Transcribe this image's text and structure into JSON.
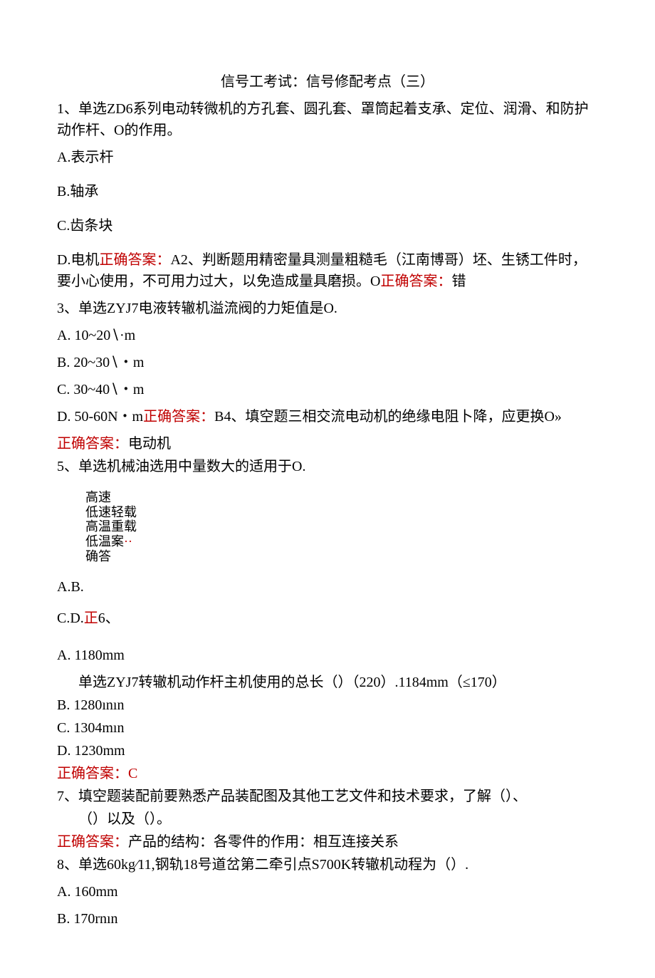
{
  "title": "信号工考试：信号修配考点（三）",
  "q1_stem": "1、单选ZD6系列电动转微机的方孔套、圆孔套、罩筒起着支承、定位、润滑、和防护动作杆、O的作用。",
  "q1_a": "A.表示杆",
  "q1_b": "B.轴承",
  "q1_c": "C.齿条块",
  "q1_d_prefix": "D.电机",
  "q1_ans_label": "正确答案：",
  "q1_ans_rest": "A2、判断题用精密量具测量粗糙毛（江南博哥）坯、生锈工件时，要小心使用，不可用力过大，以免造成量具磨损。O",
  "q2_ans_label": "正确答案：",
  "q2_ans_val": "错",
  "q3_stem": "3、单选ZYJ7电液转辙机溢流阀的力矩值是O.",
  "q3_a": "A.   10~20∖·m",
  "q3_b": "B.   20~30∖・m",
  "q3_c": "C.   30~40∖・m",
  "q3_d_prefix": "D.   50-60N・m",
  "q3_ans_label": "正确答案：",
  "q3_ans_rest": "B4、填空题三相交流电动机的绝缘电阻卜降，应更换O»",
  "q4_ans_label": "正确答案：",
  "q4_ans_val": "电动机",
  "q5_stem": "5、单选机械油选用中量数大的适用于O.",
  "q5_block_l1": "高速",
  "q5_block_l2": "低速轻载",
  "q5_block_l3": "高温重载",
  "q5_block_l4": "低温案",
  "q5_block_dots": "··",
  "q5_block_l5": "确答",
  "q5_ab": "A.B.",
  "q5_cd_prefix": "C.D.",
  "q5_cd_red": "正",
  "q5_cd_rest": "6、",
  "q6_a": "A.   1180mm",
  "q6_stem": "单选ZYJ7转辙机动作杆主机使用的总长（）（220）.1184mm（≤170）",
  "q6_b": "B.   1280ının",
  "q6_c": "C.   1304mın",
  "q6_d": "D.   1230mm",
  "q6_ans": "正确答案：C",
  "q7_stem_l1": "7、填空题装配前要熟悉产品装配图及其他工艺文件和技术要求，了解（）、",
  "q7_stem_l2": "（）以及（）。",
  "q7_ans_label": "正确答案：",
  "q7_ans_val": "产品的结构：各零件的作用：相互连接关系",
  "q8_stem": "8、单选60kg⁄11,钢轨18号道岔第二牵引点S700K转辙机动程为（）.",
  "q8_a": "A.   160mm",
  "q8_b": "B.   170rnın"
}
